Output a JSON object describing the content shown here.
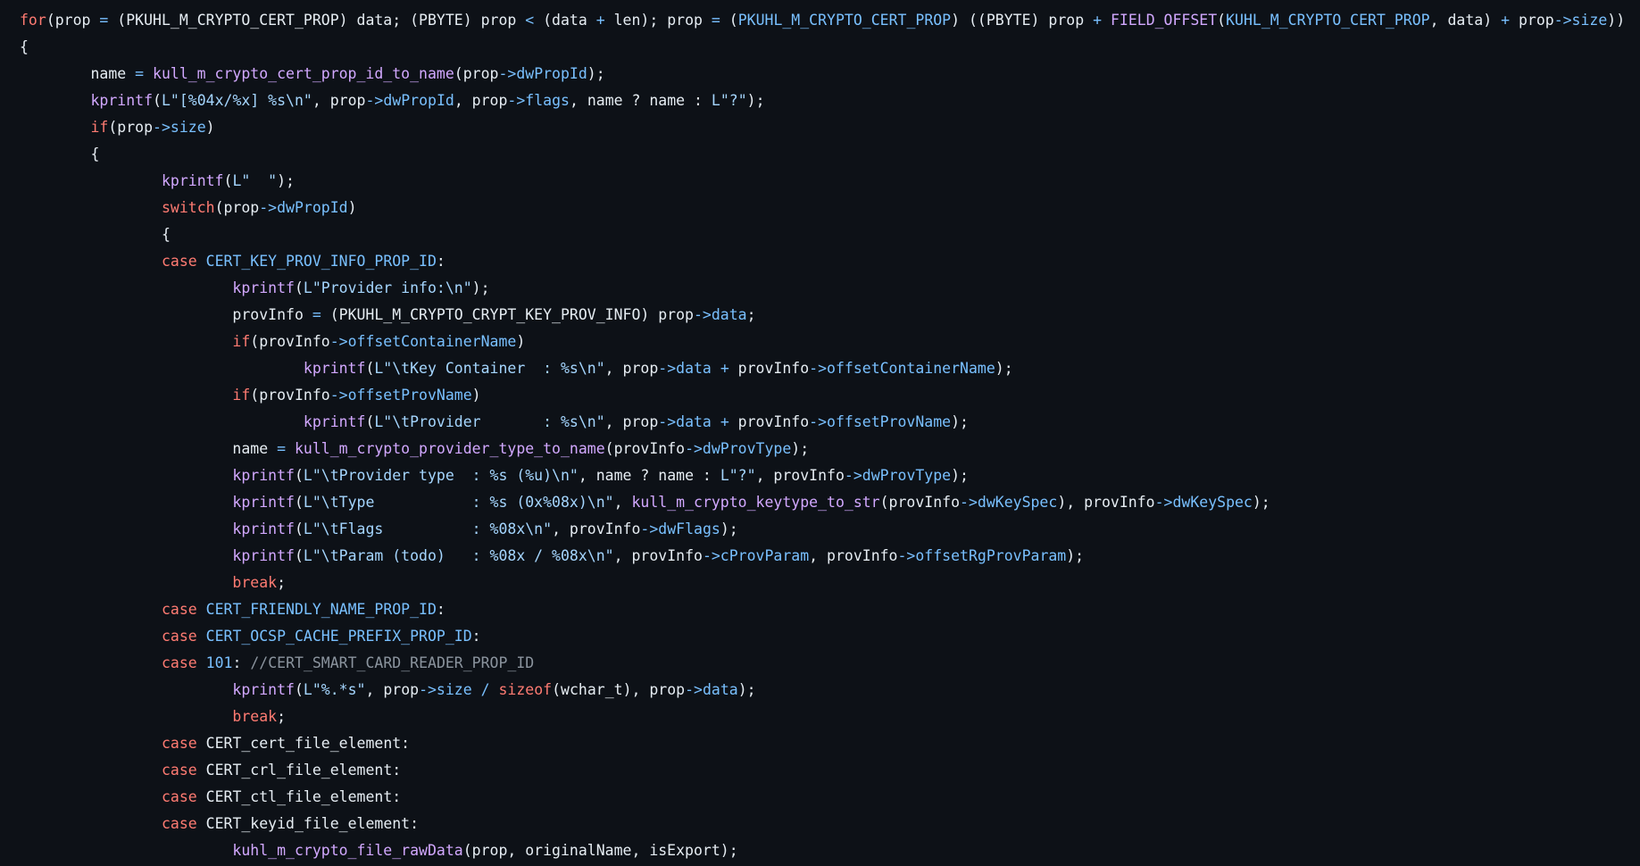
{
  "colors": {
    "background": "#0d1117",
    "plain": "#e6edf3",
    "keyword": "#ff7b72",
    "function": "#d2a8ff",
    "constant": "#79c0ff",
    "string": "#a5d6ff",
    "comment": "#8b949e"
  },
  "code": {
    "lines": [
      [
        [
          "keyword",
          "for"
        ],
        [
          "plain",
          "(prop "
        ],
        [
          "const",
          "="
        ],
        [
          "plain",
          " (PKUHL_M_CRYPTO_CERT_PROP) data; (PBYTE) prop "
        ],
        [
          "const",
          "<"
        ],
        [
          "plain",
          " (data "
        ],
        [
          "const",
          "+"
        ],
        [
          "plain",
          " len); prop "
        ],
        [
          "const",
          "="
        ],
        [
          "plain",
          " ("
        ],
        [
          "const",
          "PKUHL_M_CRYPTO_CERT_PROP"
        ],
        [
          "plain",
          ") ((PBYTE) prop "
        ],
        [
          "const",
          "+"
        ],
        [
          "plain",
          " "
        ],
        [
          "func",
          "FIELD_OFFSET"
        ],
        [
          "plain",
          "("
        ],
        [
          "const",
          "KUHL_M_CRYPTO_CERT_PROP"
        ],
        [
          "plain",
          ", data) "
        ],
        [
          "const",
          "+"
        ],
        [
          "plain",
          " prop"
        ],
        [
          "const",
          "->size"
        ],
        [
          "plain",
          "))"
        ]
      ],
      [
        [
          "plain",
          "{"
        ]
      ],
      [
        [
          "plain",
          "        name "
        ],
        [
          "const",
          "="
        ],
        [
          "plain",
          " "
        ],
        [
          "func",
          "kull_m_crypto_cert_prop_id_to_name"
        ],
        [
          "plain",
          "(prop"
        ],
        [
          "const",
          "->dwPropId"
        ],
        [
          "plain",
          ");"
        ]
      ],
      [
        [
          "plain",
          "        "
        ],
        [
          "func",
          "kprintf"
        ],
        [
          "plain",
          "("
        ],
        [
          "string",
          "L\"[%04x/%x] %s\\n\""
        ],
        [
          "plain",
          ", prop"
        ],
        [
          "const",
          "->dwPropId"
        ],
        [
          "plain",
          ", prop"
        ],
        [
          "const",
          "->flags"
        ],
        [
          "plain",
          ", name ? name : "
        ],
        [
          "string",
          "L\"?\""
        ],
        [
          "plain",
          ");"
        ]
      ],
      [
        [
          "plain",
          "        "
        ],
        [
          "keyword",
          "if"
        ],
        [
          "plain",
          "(prop"
        ],
        [
          "const",
          "->size"
        ],
        [
          "plain",
          ")"
        ]
      ],
      [
        [
          "plain",
          "        {"
        ]
      ],
      [
        [
          "plain",
          "                "
        ],
        [
          "func",
          "kprintf"
        ],
        [
          "plain",
          "("
        ],
        [
          "string",
          "L\"  \""
        ],
        [
          "plain",
          ");"
        ]
      ],
      [
        [
          "plain",
          "                "
        ],
        [
          "keyword",
          "switch"
        ],
        [
          "plain",
          "(prop"
        ],
        [
          "const",
          "->dwPropId"
        ],
        [
          "plain",
          ")"
        ]
      ],
      [
        [
          "plain",
          "                {"
        ]
      ],
      [
        [
          "plain",
          "                "
        ],
        [
          "keyword",
          "case"
        ],
        [
          "plain",
          " "
        ],
        [
          "const",
          "CERT_KEY_PROV_INFO_PROP_ID"
        ],
        [
          "plain",
          ":"
        ]
      ],
      [
        [
          "plain",
          "                        "
        ],
        [
          "func",
          "kprintf"
        ],
        [
          "plain",
          "("
        ],
        [
          "string",
          "L\"Provider info:\\n\""
        ],
        [
          "plain",
          ");"
        ]
      ],
      [
        [
          "plain",
          "                        provInfo "
        ],
        [
          "const",
          "="
        ],
        [
          "plain",
          " (PKUHL_M_CRYPTO_CRYPT_KEY_PROV_INFO) prop"
        ],
        [
          "const",
          "->data"
        ],
        [
          "plain",
          ";"
        ]
      ],
      [
        [
          "plain",
          "                        "
        ],
        [
          "keyword",
          "if"
        ],
        [
          "plain",
          "(provInfo"
        ],
        [
          "const",
          "->offsetContainerName"
        ],
        [
          "plain",
          ")"
        ]
      ],
      [
        [
          "plain",
          "                                "
        ],
        [
          "func",
          "kprintf"
        ],
        [
          "plain",
          "("
        ],
        [
          "string",
          "L\"\\tKey Container  : %s\\n\""
        ],
        [
          "plain",
          ", prop"
        ],
        [
          "const",
          "->data"
        ],
        [
          "plain",
          " "
        ],
        [
          "const",
          "+"
        ],
        [
          "plain",
          " provInfo"
        ],
        [
          "const",
          "->offsetContainerName"
        ],
        [
          "plain",
          ");"
        ]
      ],
      [
        [
          "plain",
          "                        "
        ],
        [
          "keyword",
          "if"
        ],
        [
          "plain",
          "(provInfo"
        ],
        [
          "const",
          "->offsetProvName"
        ],
        [
          "plain",
          ")"
        ]
      ],
      [
        [
          "plain",
          "                                "
        ],
        [
          "func",
          "kprintf"
        ],
        [
          "plain",
          "("
        ],
        [
          "string",
          "L\"\\tProvider       : %s\\n\""
        ],
        [
          "plain",
          ", prop"
        ],
        [
          "const",
          "->data"
        ],
        [
          "plain",
          " "
        ],
        [
          "const",
          "+"
        ],
        [
          "plain",
          " provInfo"
        ],
        [
          "const",
          "->offsetProvName"
        ],
        [
          "plain",
          ");"
        ]
      ],
      [
        [
          "plain",
          "                        name "
        ],
        [
          "const",
          "="
        ],
        [
          "plain",
          " "
        ],
        [
          "func",
          "kull_m_crypto_provider_type_to_name"
        ],
        [
          "plain",
          "(provInfo"
        ],
        [
          "const",
          "->dwProvType"
        ],
        [
          "plain",
          ");"
        ]
      ],
      [
        [
          "plain",
          "                        "
        ],
        [
          "func",
          "kprintf"
        ],
        [
          "plain",
          "("
        ],
        [
          "string",
          "L\"\\tProvider type  : %s (%u)\\n\""
        ],
        [
          "plain",
          ", name ? name : "
        ],
        [
          "string",
          "L\"?\""
        ],
        [
          "plain",
          ", provInfo"
        ],
        [
          "const",
          "->dwProvType"
        ],
        [
          "plain",
          ");"
        ]
      ],
      [
        [
          "plain",
          "                        "
        ],
        [
          "func",
          "kprintf"
        ],
        [
          "plain",
          "("
        ],
        [
          "string",
          "L\"\\tType           : %s (0x%08x)\\n\""
        ],
        [
          "plain",
          ", "
        ],
        [
          "func",
          "kull_m_crypto_keytype_to_str"
        ],
        [
          "plain",
          "(provInfo"
        ],
        [
          "const",
          "->dwKeySpec"
        ],
        [
          "plain",
          "), provInfo"
        ],
        [
          "const",
          "->dwKeySpec"
        ],
        [
          "plain",
          ");"
        ]
      ],
      [
        [
          "plain",
          "                        "
        ],
        [
          "func",
          "kprintf"
        ],
        [
          "plain",
          "("
        ],
        [
          "string",
          "L\"\\tFlags          : %08x\\n\""
        ],
        [
          "plain",
          ", provInfo"
        ],
        [
          "const",
          "->dwFlags"
        ],
        [
          "plain",
          ");"
        ]
      ],
      [
        [
          "plain",
          "                        "
        ],
        [
          "func",
          "kprintf"
        ],
        [
          "plain",
          "("
        ],
        [
          "string",
          "L\"\\tParam (todo)   : %08x / %08x\\n\""
        ],
        [
          "plain",
          ", provInfo"
        ],
        [
          "const",
          "->cProvParam"
        ],
        [
          "plain",
          ", provInfo"
        ],
        [
          "const",
          "->offsetRgProvParam"
        ],
        [
          "plain",
          ");"
        ]
      ],
      [
        [
          "plain",
          "                        "
        ],
        [
          "keyword",
          "break"
        ],
        [
          "plain",
          ";"
        ]
      ],
      [
        [
          "plain",
          "                "
        ],
        [
          "keyword",
          "case"
        ],
        [
          "plain",
          " "
        ],
        [
          "const",
          "CERT_FRIENDLY_NAME_PROP_ID"
        ],
        [
          "plain",
          ":"
        ]
      ],
      [
        [
          "plain",
          "                "
        ],
        [
          "keyword",
          "case"
        ],
        [
          "plain",
          " "
        ],
        [
          "const",
          "CERT_OCSP_CACHE_PREFIX_PROP_ID"
        ],
        [
          "plain",
          ":"
        ]
      ],
      [
        [
          "plain",
          "                "
        ],
        [
          "keyword",
          "case"
        ],
        [
          "plain",
          " "
        ],
        [
          "const",
          "101"
        ],
        [
          "plain",
          ": "
        ],
        [
          "comment",
          "//CERT_SMART_CARD_READER_PROP_ID"
        ]
      ],
      [
        [
          "plain",
          "                        "
        ],
        [
          "func",
          "kprintf"
        ],
        [
          "plain",
          "("
        ],
        [
          "string",
          "L\"%.*s\""
        ],
        [
          "plain",
          ", prop"
        ],
        [
          "const",
          "->size"
        ],
        [
          "plain",
          " "
        ],
        [
          "const",
          "/"
        ],
        [
          "plain",
          " "
        ],
        [
          "keyword",
          "sizeof"
        ],
        [
          "plain",
          "(wchar_t), prop"
        ],
        [
          "const",
          "->data"
        ],
        [
          "plain",
          ");"
        ]
      ],
      [
        [
          "plain",
          "                        "
        ],
        [
          "keyword",
          "break"
        ],
        [
          "plain",
          ";"
        ]
      ],
      [
        [
          "plain",
          "                "
        ],
        [
          "keyword",
          "case"
        ],
        [
          "plain",
          " CERT_cert_file_element:"
        ]
      ],
      [
        [
          "plain",
          "                "
        ],
        [
          "keyword",
          "case"
        ],
        [
          "plain",
          " CERT_crl_file_element:"
        ]
      ],
      [
        [
          "plain",
          "                "
        ],
        [
          "keyword",
          "case"
        ],
        [
          "plain",
          " CERT_ctl_file_element:"
        ]
      ],
      [
        [
          "plain",
          "                "
        ],
        [
          "keyword",
          "case"
        ],
        [
          "plain",
          " CERT_keyid_file_element:"
        ]
      ],
      [
        [
          "plain",
          "                        "
        ],
        [
          "func",
          "kuhl_m_crypto_file_rawData"
        ],
        [
          "plain",
          "(prop, originalName, isExport);"
        ]
      ]
    ]
  }
}
